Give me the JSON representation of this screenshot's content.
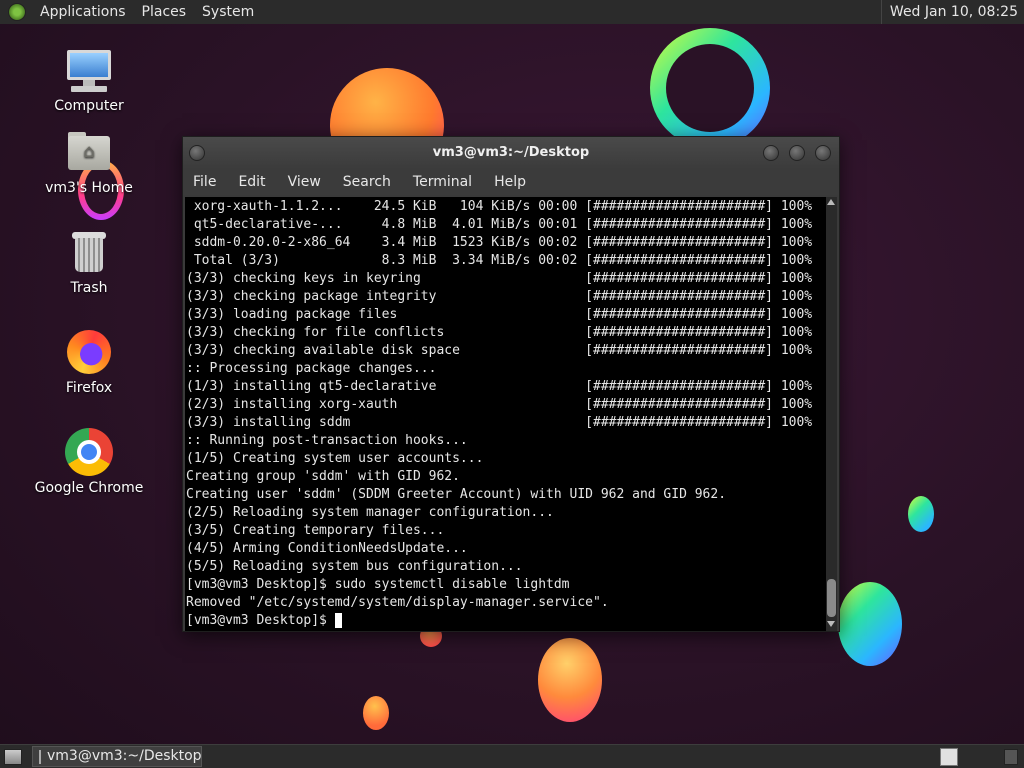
{
  "top_panel": {
    "menus": [
      "Applications",
      "Places",
      "System"
    ],
    "clock": "Wed Jan 10, 08:25"
  },
  "desktop_icons": [
    {
      "label": "Computer",
      "icon": "computer-icon"
    },
    {
      "label": "vm3's Home",
      "icon": "home-folder-icon"
    },
    {
      "label": "Trash",
      "icon": "trash-icon"
    },
    {
      "label": "Firefox",
      "icon": "firefox-icon"
    },
    {
      "label": "Google Chrome",
      "icon": "chrome-icon"
    }
  ],
  "terminal": {
    "title": "vm3@vm3:~/Desktop",
    "menu": [
      "File",
      "Edit",
      "View",
      "Search",
      "Terminal",
      "Help"
    ],
    "lines": [
      " xorg-xauth-1.1.2...    24.5 KiB   104 KiB/s 00:00 [######################] 100%",
      " qt5-declarative-...     4.8 MiB  4.01 MiB/s 00:01 [######################] 100%",
      " sddm-0.20.0-2-x86_64    3.4 MiB  1523 KiB/s 00:02 [######################] 100%",
      " Total (3/3)             8.3 MiB  3.34 MiB/s 00:02 [######################] 100%",
      "(3/3) checking keys in keyring                     [######################] 100%",
      "(3/3) checking package integrity                   [######################] 100%",
      "(3/3) loading package files                        [######################] 100%",
      "(3/3) checking for file conflicts                  [######################] 100%",
      "(3/3) checking available disk space                [######################] 100%",
      ":: Processing package changes...",
      "(1/3) installing qt5-declarative                   [######################] 100%",
      "(2/3) installing xorg-xauth                        [######################] 100%",
      "(3/3) installing sddm                              [######################] 100%",
      ":: Running post-transaction hooks...",
      "(1/5) Creating system user accounts...",
      "Creating group 'sddm' with GID 962.",
      "Creating user 'sddm' (SDDM Greeter Account) with UID 962 and GID 962.",
      "(2/5) Reloading system manager configuration...",
      "(3/5) Creating temporary files...",
      "(4/5) Arming ConditionNeedsUpdate...",
      "(5/5) Reloading system bus configuration...",
      "[vm3@vm3 Desktop]$ sudo systemctl disable lightdm",
      "Removed \"/etc/systemd/system/display-manager.service\"."
    ],
    "prompt": "[vm3@vm3 Desktop]$ "
  },
  "taskbar": {
    "task_label": "vm3@vm3:~/Desktop"
  }
}
